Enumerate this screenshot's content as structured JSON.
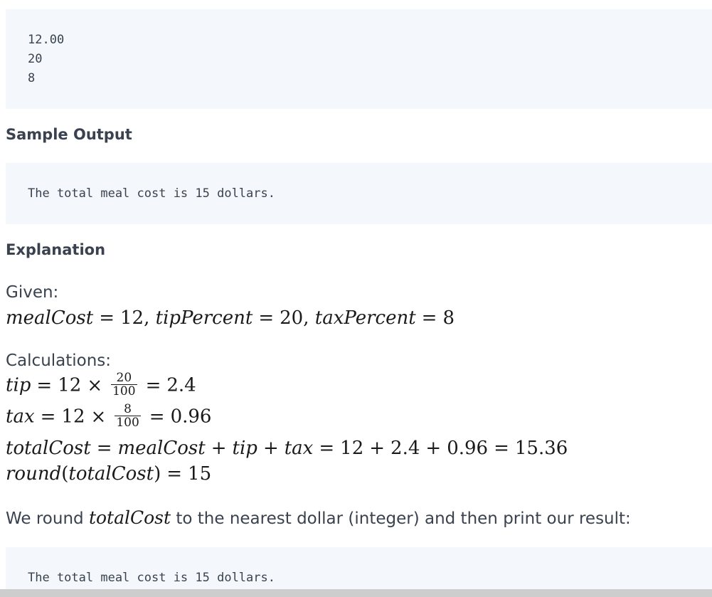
{
  "sample_input": {
    "lines": [
      "12.00",
      "20",
      "8"
    ]
  },
  "sample_output": {
    "heading": "Sample Output",
    "text": "The total meal cost is 15 dollars."
  },
  "explanation": {
    "heading": "Explanation",
    "given_label": "Given:",
    "given": {
      "meal_cost_var": "mealCost",
      "meal_cost_val": "12",
      "tip_percent_var": "tipPercent",
      "tip_percent_val": "20",
      "tax_percent_var": "taxPercent",
      "tax_percent_val": "8"
    },
    "calculations_label": "Calculations:",
    "tip": {
      "var": "tip",
      "base": "12",
      "num": "20",
      "den": "100",
      "result": "2.4"
    },
    "tax": {
      "var": "tax",
      "base": "12",
      "num": "8",
      "den": "100",
      "result": "0.96"
    },
    "total": {
      "var": "totalCost",
      "meal_var": "mealCost",
      "tip_var": "tip",
      "tax_var": "tax",
      "v1": "12",
      "v2": "2.4",
      "v3": "0.96",
      "result": "15.36"
    },
    "round": {
      "fn": "round",
      "arg": "totalCost",
      "result": "15"
    },
    "conclusion": {
      "before": "We round ",
      "var": "totalCost",
      "after": " to the nearest dollar (integer) and then print our result:"
    },
    "final_output": "The total meal cost is 15 dollars."
  }
}
